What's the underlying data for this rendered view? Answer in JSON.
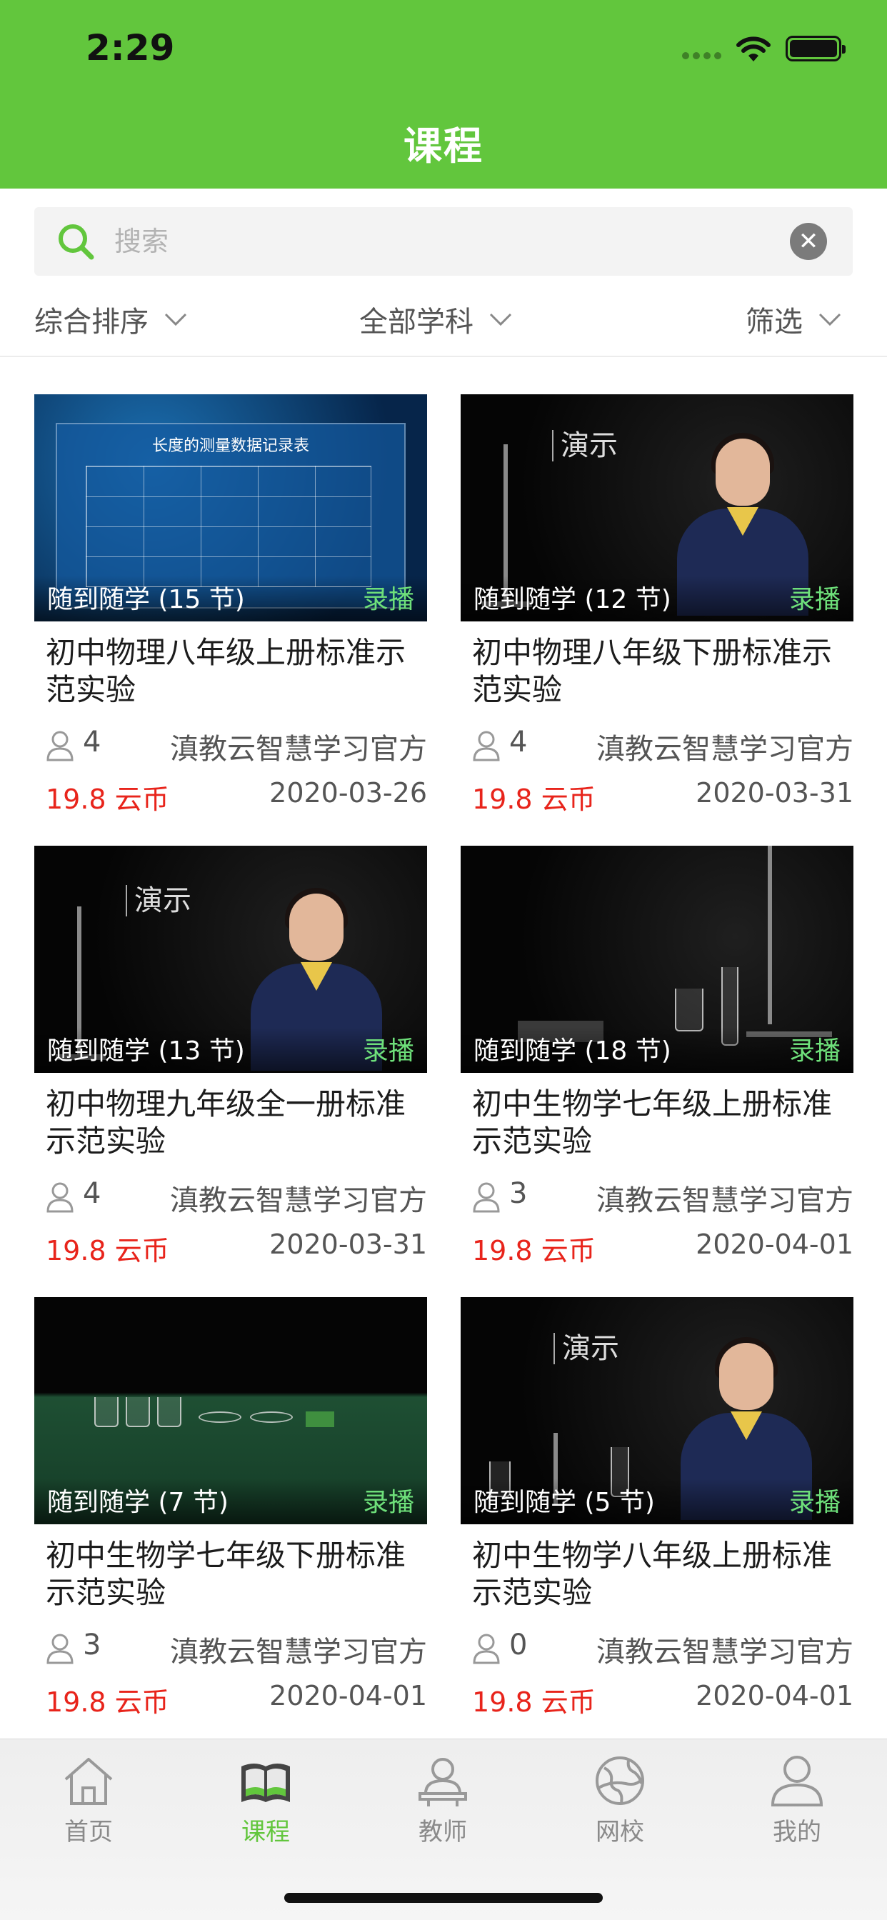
{
  "status_bar": {
    "time": "2:29"
  },
  "header": {
    "title": "课程"
  },
  "search": {
    "placeholder": "搜索",
    "value": "",
    "clear_symbol": "✕"
  },
  "filters": [
    {
      "label": "综合排序"
    },
    {
      "label": "全部学科"
    },
    {
      "label": "筛选"
    }
  ],
  "courses": [
    {
      "thumb_caption": "随到随学 (15 节)",
      "badge": "录播",
      "title": "初中物理八年级上册标准示范实验",
      "students": "4",
      "teacher": "滇教云智慧学习官方",
      "price": "19.8 云币",
      "date": "2020-03-26",
      "thumb_text": "长度的测量数据记录表"
    },
    {
      "thumb_caption": "随到随学 (12 节)",
      "badge": "录播",
      "title": "初中物理八年级下册标准示范实验",
      "students": "4",
      "teacher": "滇教云智慧学习官方",
      "price": "19.8 云币",
      "date": "2020-03-31",
      "thumb_text": "演示"
    },
    {
      "thumb_caption": "随到随学 (13 节)",
      "badge": "录播",
      "title": "初中物理九年级全一册标准示范实验",
      "students": "4",
      "teacher": "滇教云智慧学习官方",
      "price": "19.8 云币",
      "date": "2020-03-31",
      "thumb_text": "演示"
    },
    {
      "thumb_caption": "随到随学 (18 节)",
      "badge": "录播",
      "title": "初中生物学七年级上册标准示范实验",
      "students": "3",
      "teacher": "滇教云智慧学习官方",
      "price": "19.8 云币",
      "date": "2020-04-01",
      "thumb_text": ""
    },
    {
      "thumb_caption": "随到随学 (7 节)",
      "badge": "录播",
      "title": "初中生物学七年级下册标准示范实验",
      "students": "3",
      "teacher": "滇教云智慧学习官方",
      "price": "19.8 云币",
      "date": "2020-04-01",
      "thumb_text": ""
    },
    {
      "thumb_caption": "随到随学 (5 节)",
      "badge": "录播",
      "title": "初中生物学八年级上册标准示范实验",
      "students": "0",
      "teacher": "滇教云智慧学习官方",
      "price": "19.8 云币",
      "date": "2020-04-01",
      "thumb_text": "演示"
    }
  ],
  "tab_bar": {
    "items": [
      {
        "label": "首页",
        "icon": "home-icon",
        "active": false
      },
      {
        "label": "课程",
        "icon": "book-icon",
        "active": true
      },
      {
        "label": "教师",
        "icon": "teacher-icon",
        "active": false
      },
      {
        "label": "网校",
        "icon": "globe-icon",
        "active": false
      },
      {
        "label": "我的",
        "icon": "profile-icon",
        "active": false
      }
    ]
  },
  "colors": {
    "brand_green": "#62c63d",
    "price_red": "#e8241b",
    "badge_green": "#6ee07a",
    "text_gray": "#555555"
  }
}
